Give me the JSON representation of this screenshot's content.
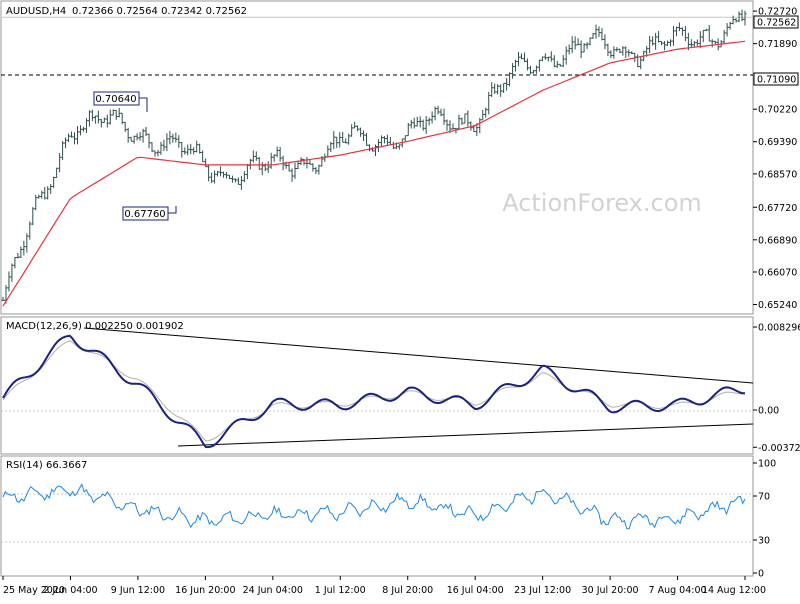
{
  "header": {
    "symbol": "AUDUSD,H4",
    "ohlc": "0.72366 0.72564 0.72342 0.72562"
  },
  "watermark": "ActionForex.com",
  "colors": {
    "background": "#ffffff",
    "bar": "#2f4f4f",
    "ma": "#e8323c",
    "macd": "#1a237e",
    "signal": "#b0b0b0",
    "rsi": "#1e88e5",
    "grid": "#c8c8c8",
    "trendline": "#000000",
    "watermark": "#cfd3d6"
  },
  "price_panel": {
    "y_ticks": [
      "0.72720",
      "0.71890",
      "0.70220",
      "0.69390",
      "0.68570",
      "0.67720",
      "0.66890",
      "0.66070",
      "0.65240"
    ],
    "current_price": "0.72562",
    "reference_line": "0.71090",
    "annotations": [
      "0.70640",
      "0.67760"
    ]
  },
  "macd_panel": {
    "title": "MACD(12,26,9) 0.002250 0.001902",
    "y_ticks": [
      "0.008296",
      "0.00",
      "-0.003725"
    ]
  },
  "rsi_panel": {
    "title": "RSI(14) 66.3667",
    "y_ticks": [
      "100",
      "70",
      "30",
      "0"
    ]
  },
  "x_axis": {
    "labels": [
      "25 May 2020",
      "2 Jun 04:00",
      "9 Jun 12:00",
      "16 Jun 20:00",
      "24 Jun 04:00",
      "1 Jul 12:00",
      "8 Jul 20:00",
      "16 Jul 04:00",
      "23 Jul 12:00",
      "30 Jul 20:00",
      "7 Aug 04:00",
      "14 Aug 12:00"
    ]
  },
  "chart_data": [
    {
      "type": "line",
      "title": "AUDUSD,H4",
      "x": [
        "25 May 2020",
        "2 Jun 04:00",
        "9 Jun 12:00",
        "16 Jun 20:00",
        "24 Jun 04:00",
        "1 Jul 12:00",
        "8 Jul 20:00",
        "16 Jul 04:00",
        "23 Jul 12:00",
        "30 Jul 20:00",
        "7 Aug 04:00",
        "14 Aug 12:00"
      ],
      "series": [
        {
          "name": "",
          "values": [
            0.6535,
            0.6985,
            0.6976,
            0.6872,
            0.6866,
            0.693,
            0.6965,
            0.701,
            0.7165,
            0.718,
            0.7185,
            0.7256
          ]
        },
        {
          "name": "",
          "values": [
            0.652,
            0.6795,
            0.69,
            0.688,
            0.688,
            0.6905,
            0.694,
            0.698,
            0.707,
            0.714,
            0.7175,
            0.7195
          ]
        }
      ],
      "annotations": [
        "0.70640",
        "0.67760"
      ],
      "reference_lines": [
        0.7109
      ],
      "ylim": [
        0.6505,
        0.7285
      ]
    },
    {
      "type": "line",
      "title": "MACD(12,26,9) 0.002250 0.001902",
      "x": [
        "25 May 2020",
        "2 Jun 04:00",
        "9 Jun 12:00",
        "16 Jun 20:00",
        "24 Jun 04:00",
        "1 Jul 12:00",
        "8 Jul 20:00",
        "16 Jul 04:00",
        "23 Jul 12:00",
        "30 Jul 20:00",
        "7 Aug 04:00",
        "14 Aug 12:00"
      ],
      "series": [
        {
          "name": "",
          "values": [
            0.0012,
            0.0075,
            0.0025,
            -0.0035,
            0.0006,
            0.0005,
            0.0018,
            0.0005,
            0.004,
            0.0003,
            0.0005,
            0.0022
          ]
        },
        {
          "name": "",
          "values": [
            0.001,
            0.007,
            0.003,
            -0.003,
            0.0004,
            0.0006,
            0.0017,
            0.0007,
            0.0035,
            0.0006,
            0.0004,
            0.0019
          ]
        }
      ],
      "ylim": [
        -0.0042,
        0.0088
      ]
    },
    {
      "type": "line",
      "title": "RSI(14) 66.3667",
      "x": [
        "25 May 2020",
        "2 Jun 04:00",
        "9 Jun 12:00",
        "16 Jun 20:00",
        "24 Jun 04:00",
        "1 Jul 12:00",
        "8 Jul 20:00",
        "16 Jul 04:00",
        "23 Jul 12:00",
        "30 Jul 20:00",
        "7 Aug 04:00",
        "14 Aug 12:00"
      ],
      "series": [
        {
          "name": "",
          "values": [
            68,
            76,
            58,
            47,
            53,
            55,
            66,
            52,
            74,
            48,
            50,
            66
          ]
        }
      ],
      "reference_lines": [
        70,
        30
      ],
      "ylim": [
        0,
        100
      ]
    }
  ]
}
